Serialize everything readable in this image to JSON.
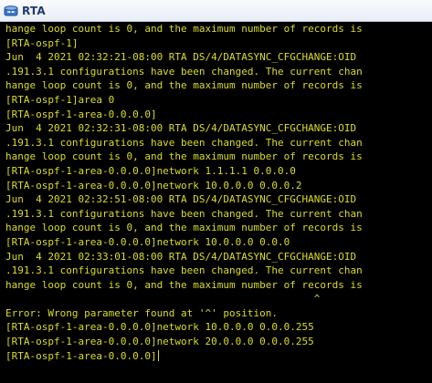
{
  "window": {
    "title": "RTA",
    "icon": "router-terminal-icon"
  },
  "colors": {
    "terminal_bg": "#000000",
    "terminal_fg": "#dcdc28",
    "titlebar_text": "#1f3b6f"
  },
  "terminal": {
    "lines": [
      "hange loop count is 0, and the maximum number of records is",
      "[RTA-ospf-1]",
      "Jun  4 2021 02:32:21-08:00 RTA DS/4/DATASYNC_CFGCHANGE:OID",
      ".191.3.1 configurations have been changed. The current chan",
      "hange loop count is 0, and the maximum number of records is",
      "[RTA-ospf-1]area 0",
      "[RTA-ospf-1-area-0.0.0.0]",
      "Jun  4 2021 02:32:31-08:00 RTA DS/4/DATASYNC_CFGCHANGE:OID",
      ".191.3.1 configurations have been changed. The current chan",
      "hange loop count is 0, and the maximum number of records is",
      "[RTA-ospf-1-area-0.0.0.0]network 1.1.1.1 0.0.0.0",
      "[RTA-ospf-1-area-0.0.0.0]network 10.0.0.0 0.0.0.2",
      "Jun  4 2021 02:32:51-08:00 RTA DS/4/DATASYNC_CFGCHANGE:OID",
      ".191.3.1 configurations have been changed. The current chan",
      "hange loop count is 0, and the maximum number of records is",
      "[RTA-ospf-1-area-0.0.0.0]network 10.0.0.0 0.0.0",
      "Jun  4 2021 02:33:01-08:00 RTA DS/4/DATASYNC_CFGCHANGE:OID",
      ".191.3.1 configurations have been changed. The current chan",
      "hange loop count is 0, and the maximum number of records is",
      "                                                   ^",
      "Error: Wrong parameter found at '^' position.",
      "[RTA-ospf-1-area-0.0.0.0]network 10.0.0.0 0.0.0.255",
      "[RTA-ospf-1-area-0.0.0.0]network 20.0.0.0 0.0.0.255",
      "[RTA-ospf-1-area-0.0.0.0]"
    ]
  }
}
